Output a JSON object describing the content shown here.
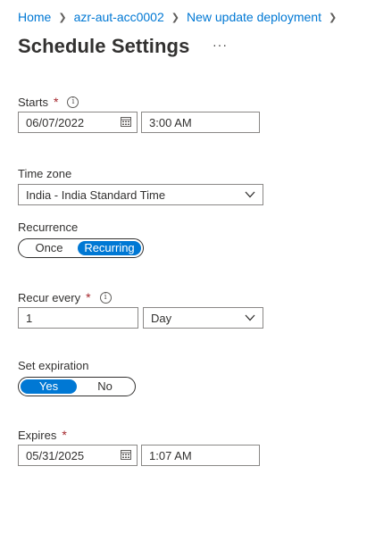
{
  "breadcrumb": [
    "Home",
    "azr-aut-acc0002",
    "New update deployment"
  ],
  "title": "Schedule Settings",
  "more": "···",
  "starts": {
    "label": "Starts",
    "required": "*",
    "date": "06/07/2022",
    "time": "3:00 AM"
  },
  "timezone": {
    "label": "Time zone",
    "value": "India - India Standard Time"
  },
  "recurrence": {
    "label": "Recurrence",
    "options": [
      "Once",
      "Recurring"
    ],
    "selected": "Recurring"
  },
  "recur_every": {
    "label": "Recur every",
    "required": "*",
    "value": "1",
    "unit": "Day"
  },
  "set_expiration": {
    "label": "Set expiration",
    "options": [
      "Yes",
      "No"
    ],
    "selected": "Yes"
  },
  "expires": {
    "label": "Expires",
    "required": "*",
    "date": "05/31/2025",
    "time": "1:07 AM"
  },
  "colors": {
    "accent": "#0078d4",
    "required": "#a4262c",
    "border": "#8a8886",
    "text": "#323130"
  }
}
